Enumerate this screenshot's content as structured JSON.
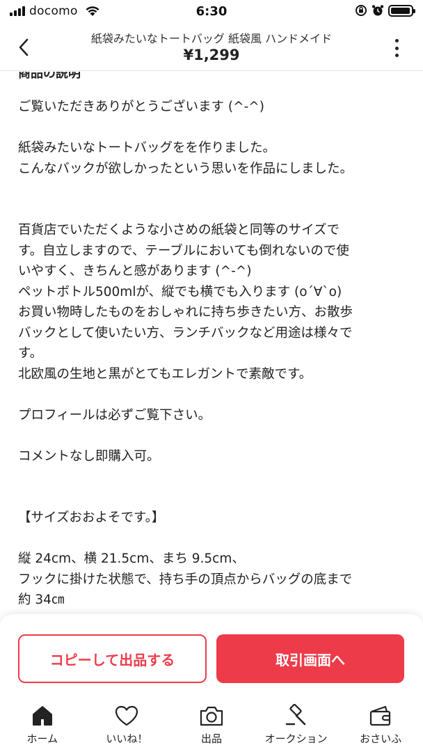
{
  "status_bar": {
    "carrier": "docomo",
    "time": "6:30",
    "signal_bars": 4,
    "battery_level": 0.95,
    "icons": [
      "signal-icon",
      "wifi-icon",
      "rotation-lock-icon",
      "alarm-icon",
      "battery-icon"
    ]
  },
  "header": {
    "title": "紙袋みたいなトートバッグ 紙袋風 ハンドメイド",
    "price": "¥1,299",
    "icons": [
      "back-chevron-icon",
      "more-vertical-icon"
    ]
  },
  "description": {
    "partial_heading": "商品の説明",
    "text": "ご覧いただきありがとうございます (^-^)\n\n紙袋みたいなトートバッグをを作りました。\nこんなバックが欲しかったという思いを作品にしました。\n\n\n百貨店でいただくような小さめの紙袋と同等のサイズで\nす。自立しますので、テーブルにおいても倒れないので使\nいやすく、きちんと感があります (^-^)\nペットボトル500mlが、縦でも横でも入ります (o´∀`o)\nお買い物時したものをおしゃれに持ち歩きたい方、お散歩\nバックとして使いたい方、ランチバックなど用途は様々で\nす。\n北欧風の生地と黒がとてもエレガントで素敵です。\n\nプロフィールは必ずご覧下さい。\n\nコメントなし即購入可。\n\n\n【サイズおおよそです。】\n\n縦 24cm、横 21.5cm、まち 9.5cm、\nフックに掛けた状態で、持ち手の頂点からバッグの底まで\n約 34㎝"
  },
  "actions": {
    "copy_label": "コピーして出品する",
    "trade_label": "取引画面へ",
    "accent_color": "#EE3B49"
  },
  "tab_bar": {
    "tabs": [
      {
        "label": "ホーム",
        "icon": "home-icon"
      },
      {
        "label": "いいね！",
        "icon": "heart-icon"
      },
      {
        "label": "出品",
        "icon": "camera-icon"
      },
      {
        "label": "オークション",
        "icon": "gavel-icon"
      },
      {
        "label": "おさいふ",
        "icon": "wallet-icon"
      }
    ]
  }
}
